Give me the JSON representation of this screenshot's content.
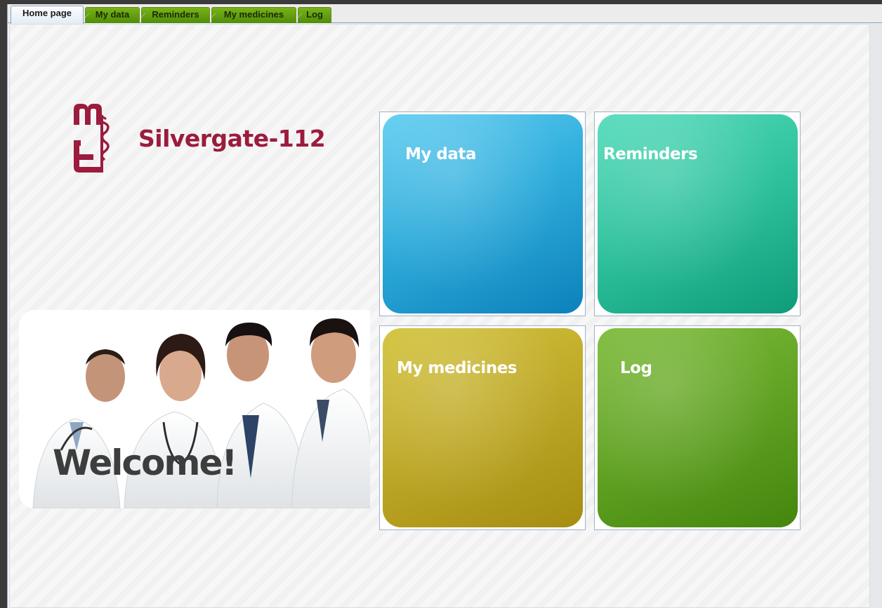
{
  "tabs": [
    {
      "label": "Home page",
      "active": true
    },
    {
      "label": "My data",
      "active": false
    },
    {
      "label": "Reminders",
      "active": false
    },
    {
      "label": "My medicines",
      "active": false
    },
    {
      "label": "Log",
      "active": false
    }
  ],
  "brand": {
    "name": "Silvergate-112",
    "logo_icon": "caduceus-me-logo-icon",
    "color": "#9b1c3d"
  },
  "welcome": {
    "text": "Welcome!",
    "image": "doctors-group-photo"
  },
  "tiles": [
    {
      "label": "My data",
      "color": "#1ea8dc"
    },
    {
      "label": "Reminders",
      "color": "#1fc39a"
    },
    {
      "label": "My medicines",
      "color": "#c2ad18"
    },
    {
      "label": "Log",
      "color": "#5ca81b"
    }
  ]
}
